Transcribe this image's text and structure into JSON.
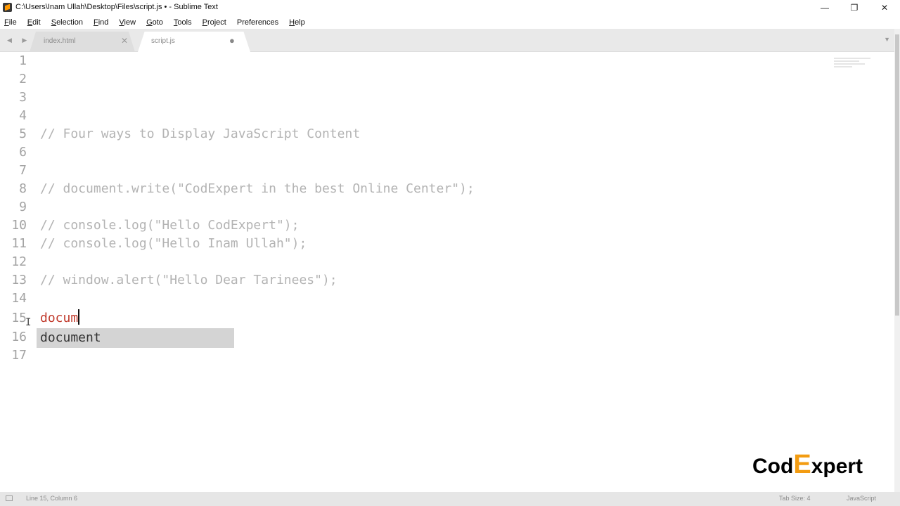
{
  "window": {
    "title": "C:\\Users\\Inam Ullah\\Desktop\\Files\\script.js • - Sublime Text",
    "minimize": "—",
    "restore": "❐",
    "close": "✕"
  },
  "menu": [
    {
      "u": "F",
      "rest": "ile"
    },
    {
      "u": "E",
      "rest": "dit"
    },
    {
      "u": "S",
      "rest": "election"
    },
    {
      "u": "F",
      "rest": "ind"
    },
    {
      "u": "V",
      "rest": "iew"
    },
    {
      "u": "G",
      "rest": "oto"
    },
    {
      "u": "T",
      "rest": "ools"
    },
    {
      "u": "P",
      "rest": "roject"
    },
    {
      "u": "",
      "rest": "Preferences"
    },
    {
      "u": "H",
      "rest": "elp"
    }
  ],
  "tabs": {
    "nav": "◀ ▶",
    "inactive": {
      "label": "index.html",
      "close": "✕"
    },
    "active": {
      "label": "script.js",
      "dirty": "●"
    },
    "dropdown": "▼"
  },
  "editor": {
    "lines": [
      {
        "num": "1",
        "text": ""
      },
      {
        "num": "2",
        "text": ""
      },
      {
        "num": "3",
        "text": ""
      },
      {
        "num": "4",
        "text": ""
      },
      {
        "num": "5",
        "text": "// Four ways to Display JavaScript Content"
      },
      {
        "num": "6",
        "text": ""
      },
      {
        "num": "7",
        "text": ""
      },
      {
        "num": "8",
        "text": "// document.write(\"CodExpert in the best Online Center\");"
      },
      {
        "num": "9",
        "text": ""
      },
      {
        "num": "10",
        "text": "// console.log(\"Hello CodExpert\");"
      },
      {
        "num": "11",
        "text": "// console.log(\"Hello Inam Ullah\");"
      },
      {
        "num": "12",
        "text": ""
      },
      {
        "num": "13",
        "text": "// window.alert(\"Hello Dear Tarinees\");"
      },
      {
        "num": "14",
        "text": ""
      },
      {
        "num": "15",
        "text": "docum"
      },
      {
        "num": "16",
        "text": ""
      },
      {
        "num": "17",
        "text": ""
      }
    ],
    "autocomplete": "document"
  },
  "watermark": {
    "part1": "Cod",
    "part2": "E",
    "part3": "xpert",
    "accent": "#f39c12"
  },
  "status": {
    "position": "Line 15, Column 6",
    "tab_size": "Tab Size: 4",
    "syntax": "JavaScript"
  }
}
